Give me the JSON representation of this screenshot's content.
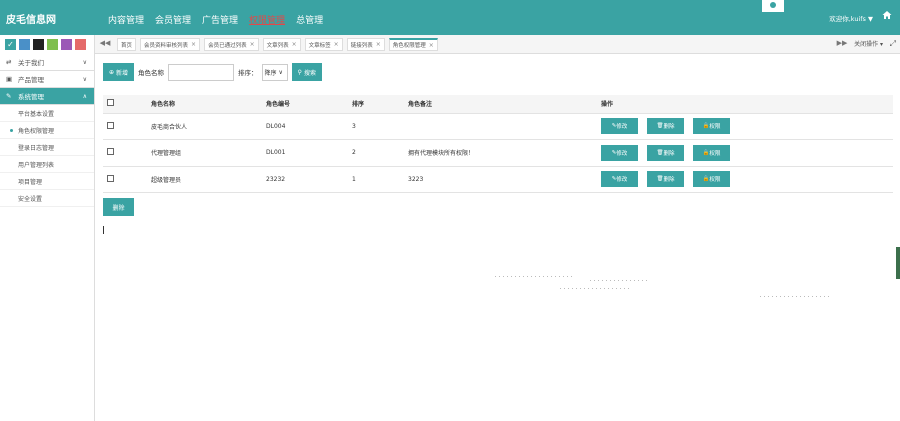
{
  "header": {
    "brand": "皮毛信息网",
    "nav": [
      "内容管理",
      "会员管理",
      "广告管理",
      "权限管理",
      "总管理"
    ],
    "active_nav": 3,
    "user": "欢迎你,kuifs ▼"
  },
  "skin_colors": [
    "#3aa3a3",
    "#4a90c8",
    "#222222",
    "#7fbf4d",
    "#9b59b6",
    "#e56a6a"
  ],
  "sidebar": {
    "sections": [
      {
        "label": "关于我们",
        "icon": "swap-icon"
      },
      {
        "label": "产品管理",
        "icon": "image-icon"
      },
      {
        "label": "系统管理",
        "icon": "wrench-icon"
      }
    ],
    "subitems": [
      "平台基本设置",
      "角色权限管理",
      "登录日志管理",
      "用户管理列表",
      "项目管理",
      "安全设置"
    ]
  },
  "tabs": {
    "items": [
      "首页",
      "会员资料审核列表",
      "会员已通过列表",
      "文章列表",
      "文章标签",
      "链接列表",
      "角色权限管理"
    ],
    "active": 6,
    "ops": "关闭操作 ▾"
  },
  "toolbar": {
    "add": "新增",
    "role_name_label": "角色名称",
    "role_name_value": "",
    "sort_label": "排序：",
    "sort_value": "降序",
    "search": "搜索"
  },
  "table": {
    "columns": [
      "角色名称",
      "角色编号",
      "排序",
      "角色备注",
      "操作"
    ],
    "rows": [
      {
        "name": "皮毛商合伙人",
        "code": "DL004",
        "sort": "3",
        "remark": ""
      },
      {
        "name": "代理管理组",
        "code": "DL001",
        "sort": "2",
        "remark": "拥有代理模块所有权限！"
      },
      {
        "name": "超级管理员",
        "code": "23232",
        "sort": "1",
        "remark": "3223"
      }
    ],
    "ops": {
      "edit": "修改",
      "delete": "删除",
      "perm": "权限"
    }
  },
  "delete_button": "删除"
}
